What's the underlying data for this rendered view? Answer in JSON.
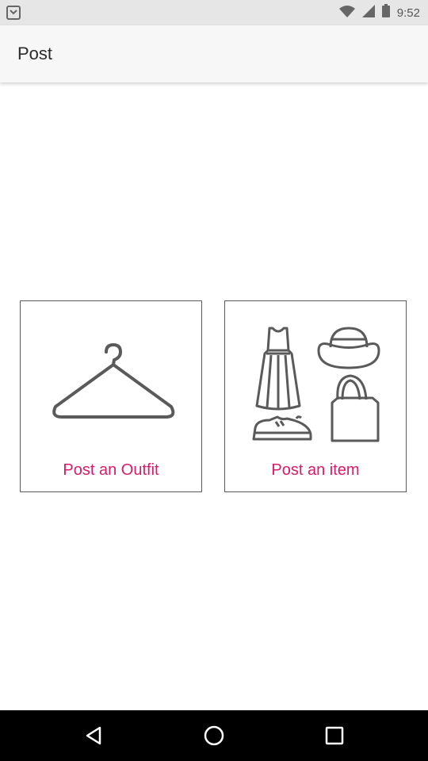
{
  "status_bar": {
    "time": "9:52",
    "icons": [
      "notification-icon",
      "wifi-icon",
      "signal-icon",
      "battery-icon"
    ]
  },
  "app_bar": {
    "title": "Post"
  },
  "cards": {
    "outfit": {
      "label": "Post an Outfit",
      "icon": "hanger-icon"
    },
    "item": {
      "label": "Post an item",
      "icons": [
        "dress-icon",
        "hat-icon",
        "sneaker-icon",
        "tote-bag-icon"
      ]
    }
  },
  "nav_bar": {
    "icons": [
      "back-icon",
      "home-icon",
      "recents-icon"
    ]
  },
  "colors": {
    "accent": "#d81b6a",
    "line_art": "#5a5a5a"
  }
}
